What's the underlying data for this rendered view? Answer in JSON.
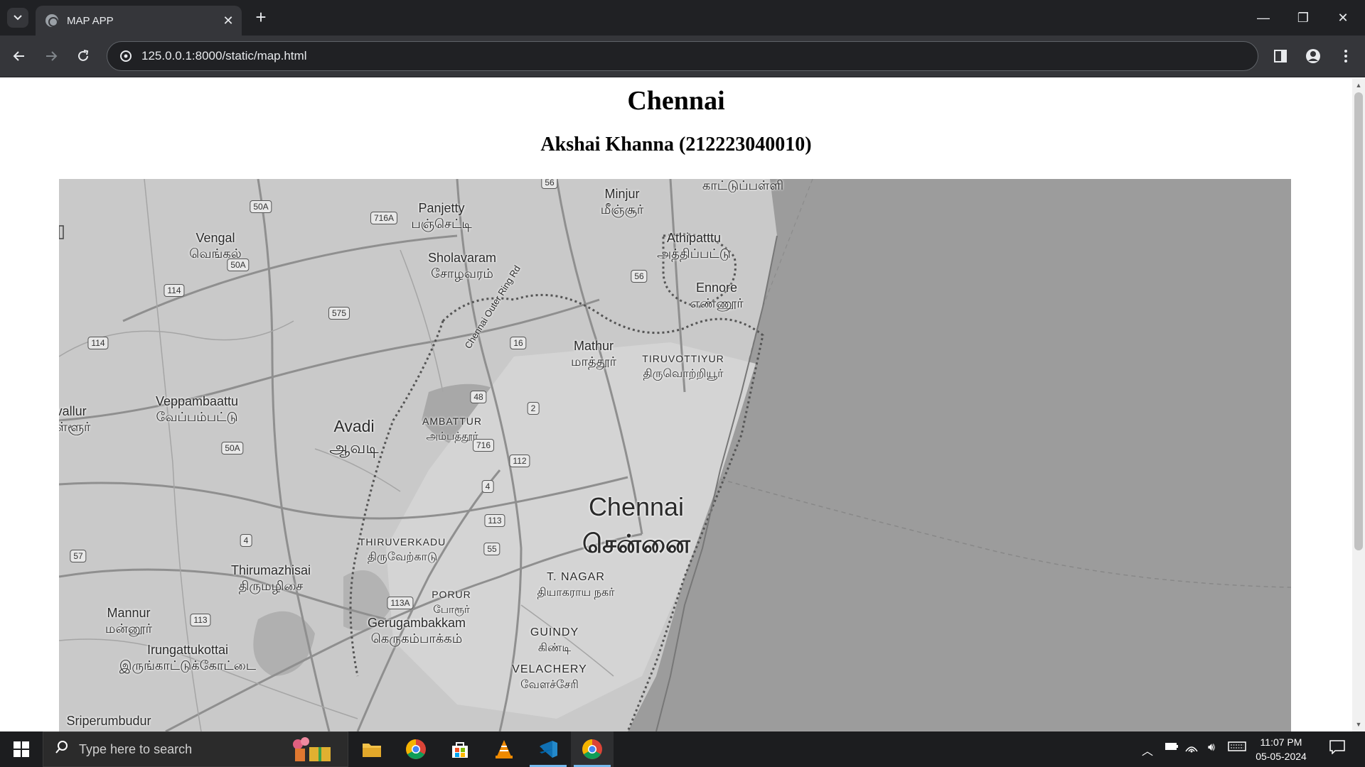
{
  "browser": {
    "tab_title": "MAP APP",
    "url": "125.0.0.1:8000/static/map.html"
  },
  "page": {
    "title": "Chennai",
    "subtitle": "Akshai Khanna (212223040010)"
  },
  "map": {
    "labels": [
      {
        "id": "minjur",
        "en": "Minjur",
        "ta": "மீஞ்சூர்"
      },
      {
        "id": "kattupalli",
        "en": "",
        "ta": "காட்டுப்பள்ளி"
      },
      {
        "id": "panjetty",
        "en": "Panjetty",
        "ta": "பஞ்செட்டி"
      },
      {
        "id": "vengal",
        "en": "Vengal",
        "ta": "வெங்கல்"
      },
      {
        "id": "sholavaram",
        "en": "Sholavaram",
        "ta": "சோழவரம்"
      },
      {
        "id": "athipattu",
        "en": "Athipatttu",
        "ta": "அத்திப்பட்டு"
      },
      {
        "id": "ennore",
        "en": "Ennore",
        "ta": "எண்ணூர்"
      },
      {
        "id": "mathur",
        "en": "Mathur",
        "ta": "மாத்தூர்"
      },
      {
        "id": "tiruvottiyur",
        "en": "TIRUVOTTIYUR",
        "ta": "திருவொற்றியூர்"
      },
      {
        "id": "veppambaattu",
        "en": "Veppambaattu",
        "ta": "வேப்பம்பட்டு"
      },
      {
        "id": "tiruvallur",
        "en": "vallur",
        "ta": "ள்ளூர்"
      },
      {
        "id": "ambattur",
        "en": "AMBATTUR",
        "ta": "அம்பத்தூர்"
      },
      {
        "id": "avadi",
        "en": "Avadi",
        "ta": "ஆவடி"
      },
      {
        "id": "chennai",
        "en": "Chennai",
        "ta": "சென்னை"
      },
      {
        "id": "thiruverkadu",
        "en": "THIRUVERKADU",
        "ta": "திருவேற்காடு"
      },
      {
        "id": "thirumazhisai",
        "en": "Thirumazhisai",
        "ta": "திருமழிசை"
      },
      {
        "id": "tnagar",
        "en": "T. NAGAR",
        "ta": "தியாகராய நகர்"
      },
      {
        "id": "porur",
        "en": "PORUR",
        "ta": "போரூர்"
      },
      {
        "id": "mannur",
        "en": "Mannur",
        "ta": "மன்னூர்"
      },
      {
        "id": "gerugambakkam",
        "en": "Gerugambakkam",
        "ta": "கெருகம்பாக்கம்"
      },
      {
        "id": "guindy",
        "en": "GUINDY",
        "ta": "கிண்டி"
      },
      {
        "id": "irungattukottai",
        "en": "Irungattukottai",
        "ta": "இருங்காட்டுக்கோட்டை"
      },
      {
        "id": "velachery",
        "en": "VELACHERY",
        "ta": "வேளச்சேரி"
      },
      {
        "id": "sriperumbudur",
        "en": "Sriperumbudur",
        "ta": ""
      }
    ],
    "road_label": "Chennai Outer Ring Rd",
    "shields": [
      "56",
      "50A",
      "716A",
      "50A",
      "114",
      "575",
      "56",
      "114",
      "16",
      "48",
      "2",
      "50A",
      "716",
      "112",
      "4",
      "113",
      "4",
      "55",
      "57",
      "113A",
      "113"
    ]
  },
  "taskbar": {
    "search_placeholder": "Type here to search",
    "time": "11:07 PM",
    "date": "05-05-2024",
    "apps": [
      "file-explorer",
      "chrome",
      "microsoft-store",
      "vlc",
      "vscode",
      "chrome-active"
    ]
  },
  "colors": {
    "map_land": "#c9c9c9",
    "map_water": "#9c9c9c",
    "chrome_dark": "#202124",
    "taskbar": "#1c1d1f",
    "tab_active_indicator": "#76b9ed"
  }
}
